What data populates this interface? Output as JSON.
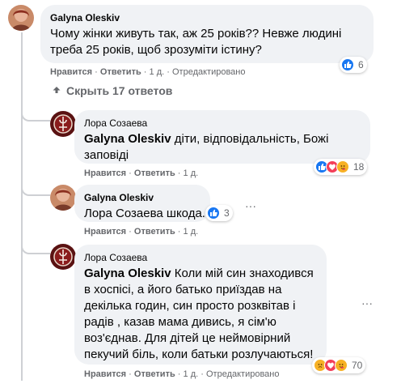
{
  "comments": [
    {
      "author": "Galyna Oleskiv",
      "text": "Чому жінки живуть так, аж 25 років?? Невже людині треба 25 років, щоб зрозуміти істину?",
      "like": "Нравится",
      "reply": "Ответить",
      "time": "1 д.",
      "edited": "Отредактировано",
      "reaction_count": "6"
    },
    {
      "author": "Лора Созаева",
      "mention": "Galyna Oleskiv",
      "text": " діти, відповідальність, Божі заповіді",
      "like": "Нравится",
      "reply": "Ответить",
      "time": "1 д.",
      "reaction_count": "18"
    },
    {
      "author": "Galyna Oleskiv",
      "mention": "Лора Созаева",
      "text": " шкода.",
      "like": "Нравится",
      "reply": "Ответить",
      "time": "1 д.",
      "reaction_count": "3"
    },
    {
      "author": "Лора Созаева",
      "mention": "Galyna Oleskiv",
      "text": " Коли мій син знаходився в хоспісі, а його батько приїздав на декілька годин, син просто розквітав і радів , казав мама дивись, я сім'ю воз'єднав. Для дітей це неймовірний пекучий біль, коли батьки розлучаються!",
      "like": "Нравится",
      "reply": "Ответить",
      "time": "1 д.",
      "edited": "Отредактировано",
      "reaction_count": "70"
    }
  ],
  "hide_replies": "Скрыть 17 ответов",
  "separator": "·",
  "more_glyph": "···",
  "colors": {
    "like_blue": "#1877f2",
    "love_red": "#f33e58",
    "haha_yellow": "#f7b125",
    "bubble": "#f0f2f5",
    "meta": "#65676b"
  }
}
